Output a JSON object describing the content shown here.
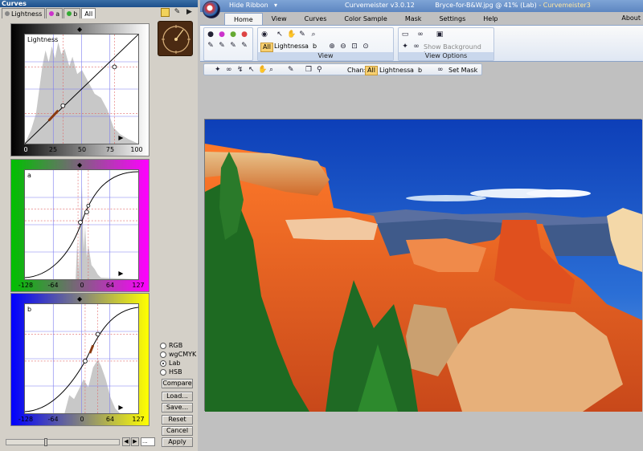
{
  "left_panel": {
    "title": "Curves",
    "tabs": [
      {
        "label": "Lightness",
        "dot": "#888888",
        "active": false
      },
      {
        "label": "a",
        "dot": "#cc33cc",
        "active": false
      },
      {
        "label": "b",
        "dot": "#33aa33",
        "active": false
      },
      {
        "label": "All",
        "dot": "",
        "active": true
      }
    ],
    "lightness": {
      "label": "Lightness",
      "ticks": [
        "0",
        "25",
        "50",
        "75",
        "100"
      ]
    },
    "a_channel": {
      "label": "a",
      "ticks": [
        "-128",
        "-64",
        "0",
        "64",
        "127"
      ]
    },
    "b_channel": {
      "label": "b",
      "ticks": [
        "-128",
        "-64",
        "0",
        "64",
        "127"
      ]
    },
    "color_modes": [
      {
        "label": "RGB",
        "selected": false
      },
      {
        "label": "wgCMYK",
        "selected": false
      },
      {
        "label": "Lab",
        "selected": true
      },
      {
        "label": "HSB",
        "selected": false
      }
    ],
    "buttons": {
      "compare": "Compare",
      "load": "Load...",
      "save": "Save...",
      "reset": "Reset",
      "cancel": "Cancel",
      "apply": "Apply"
    },
    "scroll_value": "..."
  },
  "window": {
    "hide_ribbon": "Hide Ribbon",
    "app_name": "Curvemeister v3.0.12",
    "document": "Bryce-for-B&W.jpg @ 41% (Lab)",
    "app_short": "- Curvemeister3",
    "tabs": [
      "Home",
      "View",
      "Curves",
      "Color Sample",
      "Mask",
      "Settings",
      "Help"
    ],
    "about": "About"
  },
  "ribbon": {
    "view_group": {
      "label": "View",
      "channels": [
        "All",
        "Lightness",
        "a",
        "b"
      ]
    },
    "view_options": {
      "label": "View Options",
      "show_bg": "Show Background Layers"
    }
  },
  "toolbar2": {
    "chan_label": "Chan:",
    "channels": [
      "All",
      "Lightness",
      "a",
      "b"
    ],
    "set_mask": "Set Mask"
  },
  "colors": {
    "ribbon_accent": "#8ba3c7",
    "all_highlight": "#f8d070",
    "a_panel": "#ff00ff",
    "b_panel": "#ffff00"
  }
}
